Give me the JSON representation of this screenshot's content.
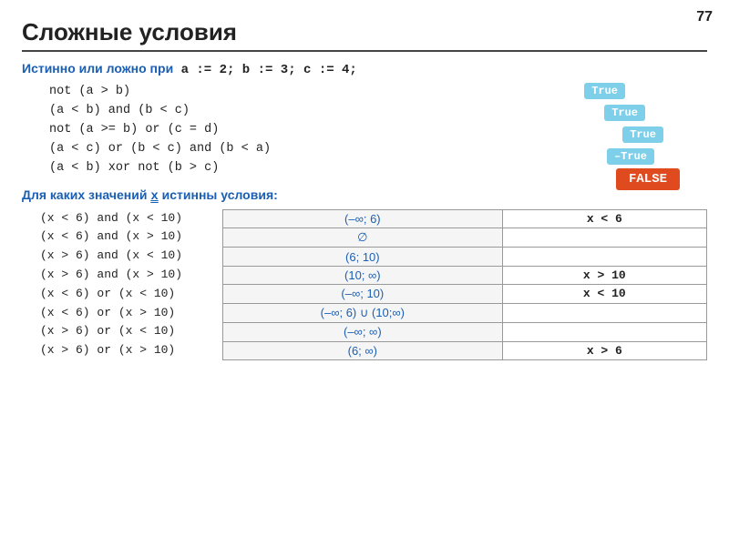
{
  "page": {
    "number": "77",
    "title": "Сложные условия"
  },
  "section1": {
    "intro_label": "Истинно или ложно при",
    "intro_code": " a := 2;  b := 3;  c := 4;",
    "lines": [
      "not (a > b)",
      "(a < b) and (b < c)",
      "not (a >= b) or (c = d)",
      "(a < c) or (b < c) and (b < a)",
      "(a < b) xor not (b > c)"
    ],
    "badges": [
      {
        "label": "True",
        "type": "true"
      },
      {
        "label": "True",
        "type": "true"
      },
      {
        "label": "True",
        "type": "true"
      },
      {
        "label": "–True",
        "type": "neg-true"
      },
      {
        "label": "FALSE",
        "type": "false"
      }
    ]
  },
  "section2": {
    "title_prefix": "Для каких значений ",
    "x_var": "x",
    "title_suffix": " истинны условия:",
    "code_lines": [
      "(x < 6) and (x < 10)",
      "(x < 6) and (x > 10)",
      "(x > 6) and (x < 10)",
      "(x > 6) and (x > 10)",
      "(x < 6) or (x < 10)",
      "(x < 6) or (x > 10)",
      "(x > 6) or (x < 10)",
      "(x > 6) or (x > 10)"
    ],
    "table": {
      "rows": [
        {
          "center": "(–∞; 6)",
          "right": "x < 6"
        },
        {
          "center": "∅",
          "right": ""
        },
        {
          "center": "(6; 10)",
          "right": ""
        },
        {
          "center": "(10; ∞)",
          "right": "x > 10"
        },
        {
          "center": "(–∞; 10)",
          "right": "x < 10"
        },
        {
          "center": "(–∞; 6) ∪ (10;∞)",
          "right": ""
        },
        {
          "center": "(–∞; ∞)",
          "right": ""
        },
        {
          "center": "(6; ∞)",
          "right": "x > 6"
        }
      ]
    }
  }
}
